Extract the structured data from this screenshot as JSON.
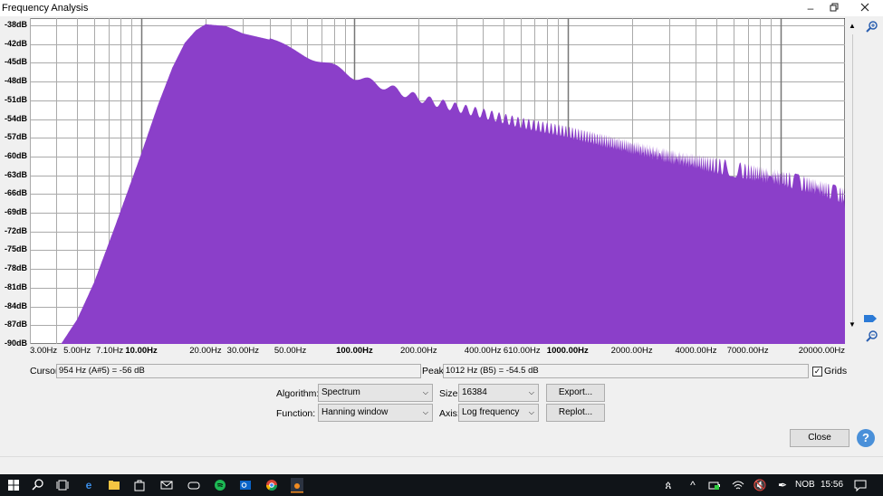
{
  "window": {
    "title": "Frequency Analysis",
    "restore_icon": "restore-icon",
    "close_icon": "close-icon"
  },
  "plot": {
    "y_ticks": [
      "-38dB",
      "-42dB",
      "-45dB",
      "-48dB",
      "-51dB",
      "-54dB",
      "-57dB",
      "-60dB",
      "-63dB",
      "-66dB",
      "-69dB",
      "-72dB",
      "-75dB",
      "-78dB",
      "-81dB",
      "-84dB",
      "-87dB",
      "-90dB"
    ],
    "x_ticks": [
      {
        "label": "3.00Hz",
        "bold": false
      },
      {
        "label": "5.00Hz",
        "bold": false
      },
      {
        "label": "7.10Hz",
        "bold": false
      },
      {
        "label": "10.00Hz",
        "bold": true
      },
      {
        "label": "20.00Hz",
        "bold": false
      },
      {
        "label": "30.00Hz",
        "bold": false
      },
      {
        "label": "50.00Hz",
        "bold": false
      },
      {
        "label": "100.00Hz",
        "bold": true
      },
      {
        "label": "200.00Hz",
        "bold": false
      },
      {
        "label": "400.00Hz",
        "bold": false
      },
      {
        "label": "610.00Hz",
        "bold": false
      },
      {
        "label": "1000.00Hz",
        "bold": true
      },
      {
        "label": "2000.00Hz",
        "bold": false
      },
      {
        "label": "4000.00Hz",
        "bold": false
      },
      {
        "label": "7000.00Hz",
        "bold": false
      },
      {
        "label": "20000.00Hz",
        "bold": false
      }
    ],
    "fill_color": "#8b3fc9"
  },
  "chart_data": {
    "type": "area",
    "title": "",
    "xlabel": "",
    "ylabel": "",
    "x_scale": "log",
    "xlim": [
      3,
      20000
    ],
    "ylim": [
      -90,
      -37
    ],
    "grid": true,
    "points": [
      [
        4.2,
        -90
      ],
      [
        5,
        -86
      ],
      [
        6,
        -80
      ],
      [
        7.5,
        -71
      ],
      [
        10,
        -59
      ],
      [
        12,
        -51
      ],
      [
        14,
        -45
      ],
      [
        16,
        -41
      ],
      [
        18,
        -39
      ],
      [
        20,
        -38
      ],
      [
        25,
        -38.3
      ],
      [
        30,
        -39.5
      ],
      [
        40,
        -40.5
      ],
      [
        50,
        -42
      ],
      [
        70,
        -44
      ],
      [
        100,
        -46.5
      ],
      [
        150,
        -48.5
      ],
      [
        200,
        -50
      ],
      [
        300,
        -51.5
      ],
      [
        400,
        -52.5
      ],
      [
        600,
        -54
      ],
      [
        1000,
        -55.5
      ],
      [
        1500,
        -57
      ],
      [
        2000,
        -58
      ],
      [
        3000,
        -59.5
      ],
      [
        5000,
        -61
      ],
      [
        7000,
        -62
      ],
      [
        10000,
        -63
      ],
      [
        15000,
        -64.5
      ],
      [
        20000,
        -66
      ]
    ]
  },
  "controls": {
    "cursor_label": "Cursor:",
    "cursor_value": "954 Hz (A#5) = -56 dB",
    "peak_label": "Peak:",
    "peak_value": "1012 Hz (B5) = -54.5 dB",
    "grids_label": "Grids",
    "grids_checked": true,
    "algorithm_label": "Algorithm:",
    "algorithm_value": "Spectrum",
    "size_label": "Size:",
    "size_value": "16384",
    "export_label": "Export...",
    "function_label": "Function:",
    "function_value": "Hanning window",
    "axis_label": "Axis:",
    "axis_value": "Log frequency",
    "replot_label": "Replot...",
    "close_label": "Close",
    "help_label": "?"
  },
  "taskbar": {
    "language": "NOB",
    "time": "15:56"
  }
}
